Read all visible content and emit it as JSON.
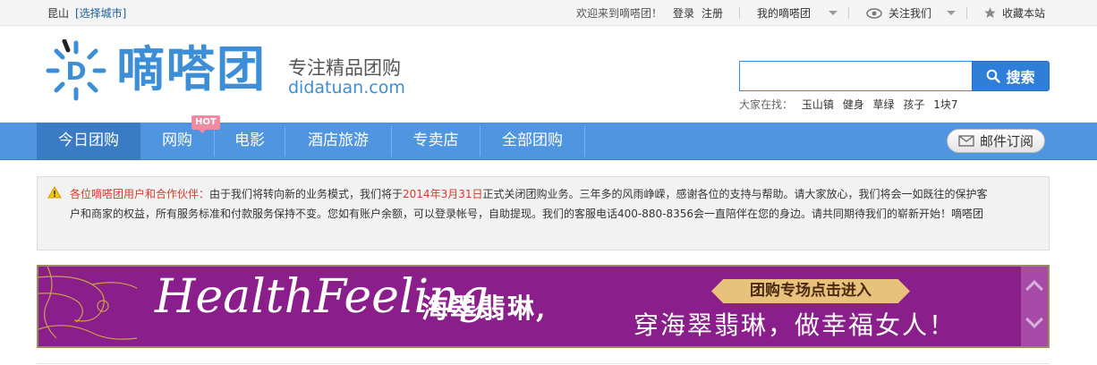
{
  "topbar": {
    "city": "昆山",
    "city_switch": "[选择城市]",
    "welcome": "欢迎来到嘀嗒团！",
    "login": "登录",
    "register": "注册",
    "my_account": "我的嘀嗒团",
    "follow_us": "关注我们",
    "bookmark": "收藏本站"
  },
  "header": {
    "logo_text": "嘀嗒团",
    "logo_letter": "D",
    "slogan": "专注精品团购",
    "domain": "didatuan.com"
  },
  "search": {
    "value": "",
    "button_label": "搜索",
    "hint_label": "大家在找：",
    "keywords": [
      "玉山镇",
      "健身",
      "草绿",
      "孩子",
      "1块7"
    ]
  },
  "nav": {
    "items": [
      {
        "label": "今日团购",
        "active": true
      },
      {
        "label": "网购",
        "badge": "HOT"
      },
      {
        "label": "电影"
      },
      {
        "label": "酒店旅游"
      },
      {
        "label": "专卖店"
      },
      {
        "label": "全部团购"
      }
    ],
    "subscribe_label": "邮件订阅"
  },
  "notice": {
    "title": "各位嘀嗒团用户和合作伙伴：",
    "part1": "由于我们将转向新的业务模式，我们将于",
    "date": "2014年3月31日",
    "part2": "正式关闭团购业务。三年多的风雨峥嵘，感谢各位的支持与帮助。请大家放心，我们将会一如既往的保护客户和商家的权益，所有服务标准和付款服务保持不变。您如有账户余额，可以登录帐号，自助提现。我们的客服电话400-880-8356会一直陪伴在您的身边。请共同期待我们的崭新开始！嘀嗒团"
  },
  "banner": {
    "script_text": "HealthFeeling",
    "brand_cn": "海翠翡琳,",
    "cta": "团购专场点击进入",
    "slogan": "穿海翠翡琳，做幸福女人！"
  },
  "colors": {
    "brand_blue": "#3c8fd6",
    "nav_blue": "#4f95df",
    "notice_red": "#d63a2a",
    "banner_purple": "#8a1e8a"
  }
}
